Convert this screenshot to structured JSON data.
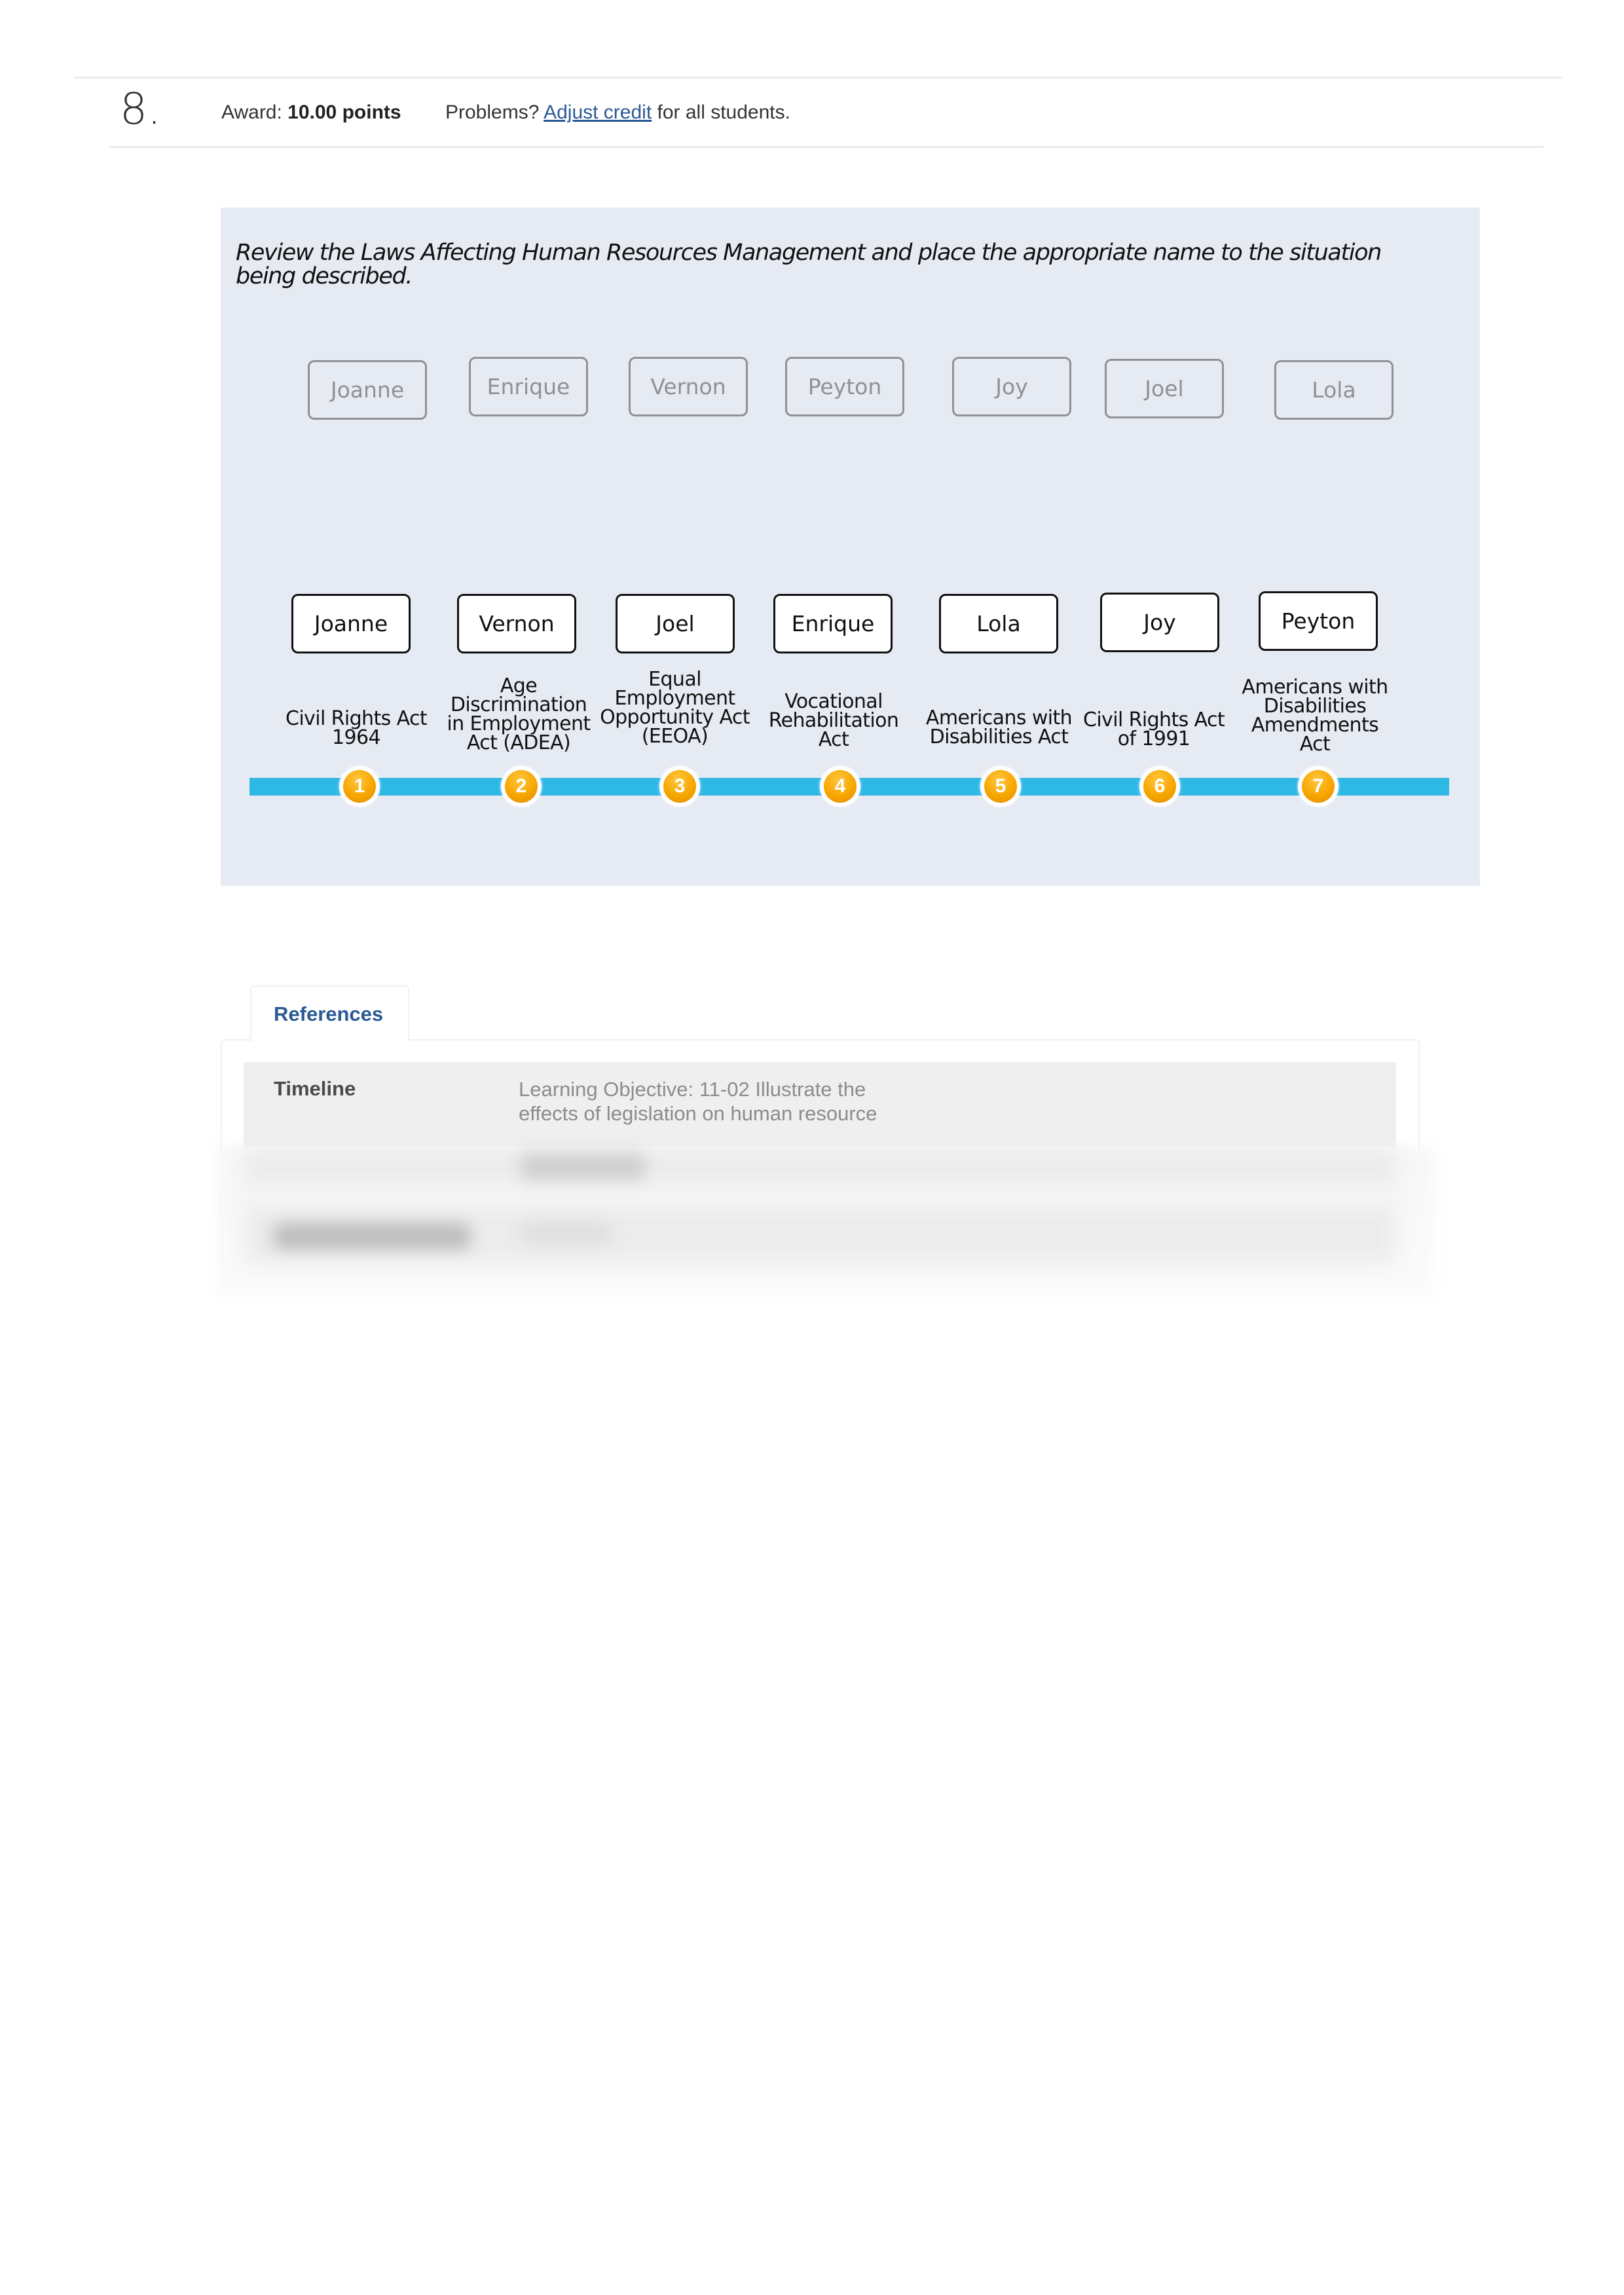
{
  "question": {
    "number": "8.",
    "award_label": "Award:",
    "award_value": "10.00 points",
    "problems_prefix": "Problems?",
    "adjust_credit_link": "Adjust credit",
    "problems_suffix": "for all students."
  },
  "activity": {
    "instructions": "Review the Laws Affecting Human Resources Management and place the appropriate name to the situation being described.",
    "source_names": [
      "Joanne",
      "Enrique",
      "Vernon",
      "Peyton",
      "Joy",
      "Joel",
      "Lola"
    ],
    "placements": [
      {
        "step": "1",
        "law": "Civil Rights Act 1964",
        "answer": "Joanne"
      },
      {
        "step": "2",
        "law": "Age Discrimination in Employment Act (ADEA)",
        "answer": "Vernon"
      },
      {
        "step": "3",
        "law": "Equal Employment Opportunity Act (EEOA)",
        "answer": "Joel"
      },
      {
        "step": "4",
        "law": "Vocational Rehabilitation Act",
        "answer": "Enrique"
      },
      {
        "step": "5",
        "law": "Americans with Disabilities Act",
        "answer": "Lola"
      },
      {
        "step": "6",
        "law": "Civil Rights Act of 1991",
        "answer": "Joy"
      },
      {
        "step": "7",
        "law": "Americans with Disabilities Amendments Act",
        "answer": "Peyton"
      }
    ],
    "colors": {
      "panel_bg": "#e6ebf3",
      "timeline_bar": "#2eb8e6",
      "marker": "#f7a600"
    }
  },
  "references": {
    "tab_label": "References",
    "rows": [
      {
        "label": "Timeline",
        "value": "Learning Objective: 11-02 Illustrate the effects of legislation on human resource"
      }
    ],
    "link_color": "#2a5a94"
  }
}
